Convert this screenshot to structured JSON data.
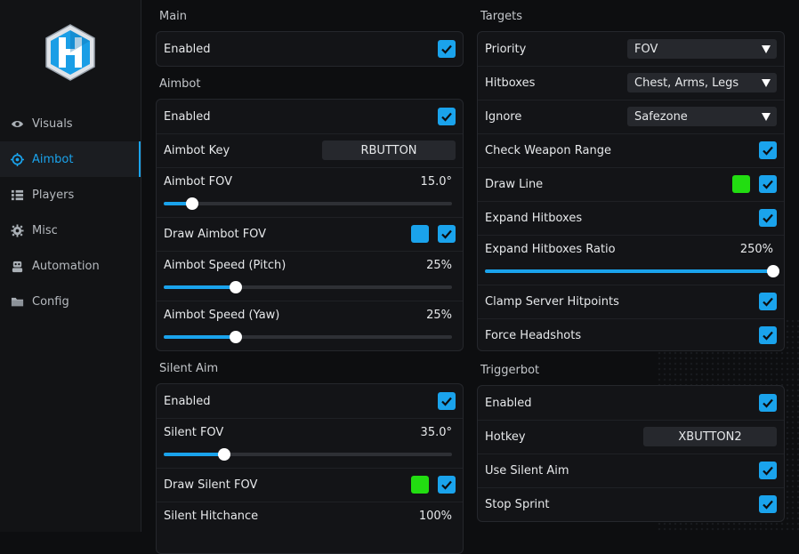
{
  "nav": [
    {
      "label": "Visuals",
      "icon": "eye-icon"
    },
    {
      "label": "Aimbot",
      "icon": "crosshair-icon",
      "active": true
    },
    {
      "label": "Players",
      "icon": "list-icon"
    },
    {
      "label": "Misc",
      "icon": "gear-icon"
    },
    {
      "label": "Automation",
      "icon": "robot-icon"
    },
    {
      "label": "Config",
      "icon": "folder-icon"
    }
  ],
  "colors": {
    "accent": "#1aa3ec",
    "swatch_blue": "#1aa3ec",
    "swatch_green": "#22dd11"
  },
  "main": {
    "title": "Main",
    "enabled_label": "Enabled",
    "enabled": true
  },
  "aimbot": {
    "title": "Aimbot",
    "enabled_label": "Enabled",
    "enabled": true,
    "key_label": "Aimbot Key",
    "key_value": "RBUTTON",
    "fov_label": "Aimbot FOV",
    "fov_value": "15.0°",
    "fov_level": 0.1,
    "draw_fov_label": "Draw Aimbot FOV",
    "draw_fov": true,
    "speed_pitch_label": "Aimbot Speed (Pitch)",
    "speed_pitch_value": "25%",
    "speed_pitch_level": 0.25,
    "speed_yaw_label": "Aimbot Speed (Yaw)",
    "speed_yaw_value": "25%",
    "speed_yaw_level": 0.25
  },
  "silent": {
    "title": "Silent Aim",
    "enabled_label": "Enabled",
    "enabled": true,
    "fov_label": "Silent FOV",
    "fov_value": "35.0°",
    "fov_level": 0.21,
    "draw_fov_label": "Draw Silent FOV",
    "draw_fov": true,
    "hitchance_label": "Silent Hitchance",
    "hitchance_value": "100%"
  },
  "targets": {
    "title": "Targets",
    "priority_label": "Priority",
    "priority_value": "FOV",
    "hitboxes_label": "Hitboxes",
    "hitboxes_value": "Chest, Arms, Legs",
    "ignore_label": "Ignore",
    "ignore_value": "Safezone",
    "check_range_label": "Check Weapon Range",
    "check_range": true,
    "draw_line_label": "Draw Line",
    "draw_line": true,
    "expand_label": "Expand Hitboxes",
    "expand": true,
    "expand_ratio_label": "Expand Hitboxes Ratio",
    "expand_ratio_value": "250%",
    "expand_ratio_level": 1.0,
    "clamp_label": "Clamp Server Hitpoints",
    "clamp": true,
    "headshots_label": "Force Headshots",
    "headshots": true
  },
  "trigger": {
    "title": "Triggerbot",
    "enabled_label": "Enabled",
    "enabled": true,
    "hotkey_label": "Hotkey",
    "hotkey_value": "XBUTTON2",
    "silent_label": "Use Silent Aim",
    "silent": true,
    "sprint_label": "Stop Sprint",
    "sprint": true
  }
}
